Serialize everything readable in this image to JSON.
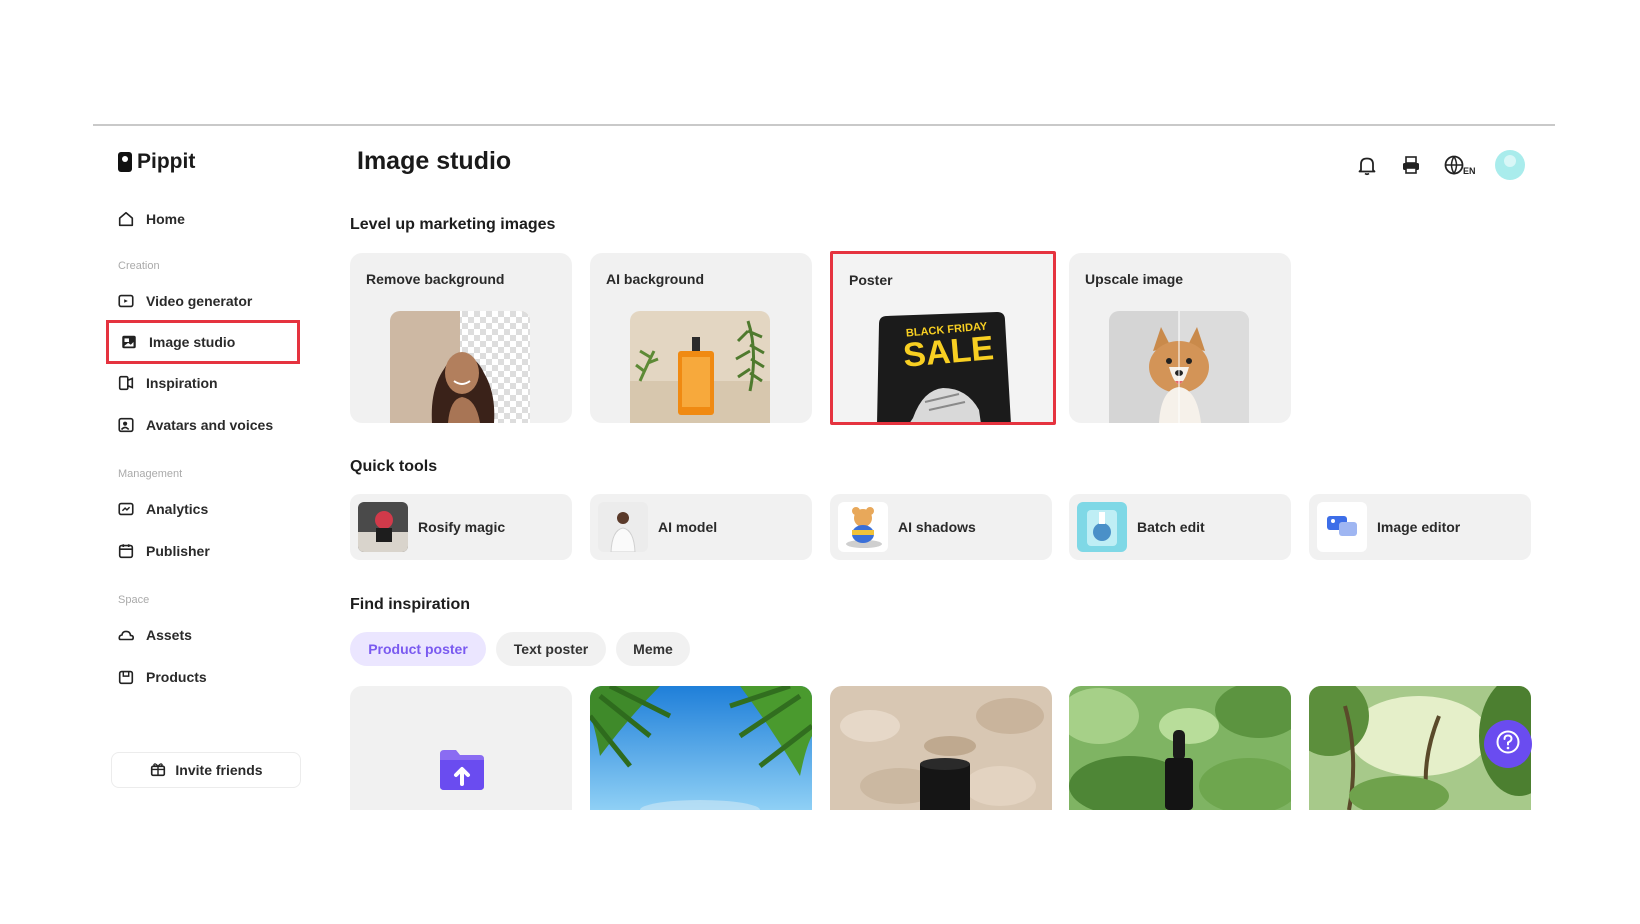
{
  "app": {
    "name": "Pippit"
  },
  "sidebar": {
    "home": "Home",
    "sections": {
      "creation": "Creation",
      "management": "Management",
      "space": "Space"
    },
    "items": {
      "video_generator": "Video generator",
      "image_studio": "Image studio",
      "inspiration": "Inspiration",
      "avatars_voices": "Avatars and voices",
      "analytics": "Analytics",
      "publisher": "Publisher",
      "assets": "Assets",
      "products": "Products"
    },
    "invite": "Invite friends",
    "selected_item": "Image studio"
  },
  "header": {
    "title": "Image studio",
    "icons": [
      "bell-icon",
      "printer-icon",
      "globe-language-icon",
      "avatar"
    ]
  },
  "marketing": {
    "title": "Level up marketing images",
    "cards": [
      {
        "label": "Remove background"
      },
      {
        "label": "AI background"
      },
      {
        "label": "Poster",
        "art_text_1": "BLACK FRIDAY",
        "art_text_2": "SALE"
      },
      {
        "label": "Upscale image"
      }
    ],
    "selected_card": "Poster"
  },
  "quick_tools": {
    "title": "Quick tools",
    "items": [
      {
        "label": "Rosify magic"
      },
      {
        "label": "AI model"
      },
      {
        "label": "AI shadows"
      },
      {
        "label": "Batch edit"
      },
      {
        "label": "Image editor"
      }
    ]
  },
  "inspiration": {
    "title": "Find inspiration",
    "chips": [
      {
        "label": "Product poster",
        "active": true
      },
      {
        "label": "Text poster",
        "active": false
      },
      {
        "label": "Meme",
        "active": false
      }
    ]
  },
  "colors": {
    "accent": "#6a4cf0",
    "highlight_box": "#e5333f",
    "card_bg": "#f1f1f1",
    "chip_active_bg": "#ebe6ff",
    "chip_active_text": "#7a5af0"
  }
}
